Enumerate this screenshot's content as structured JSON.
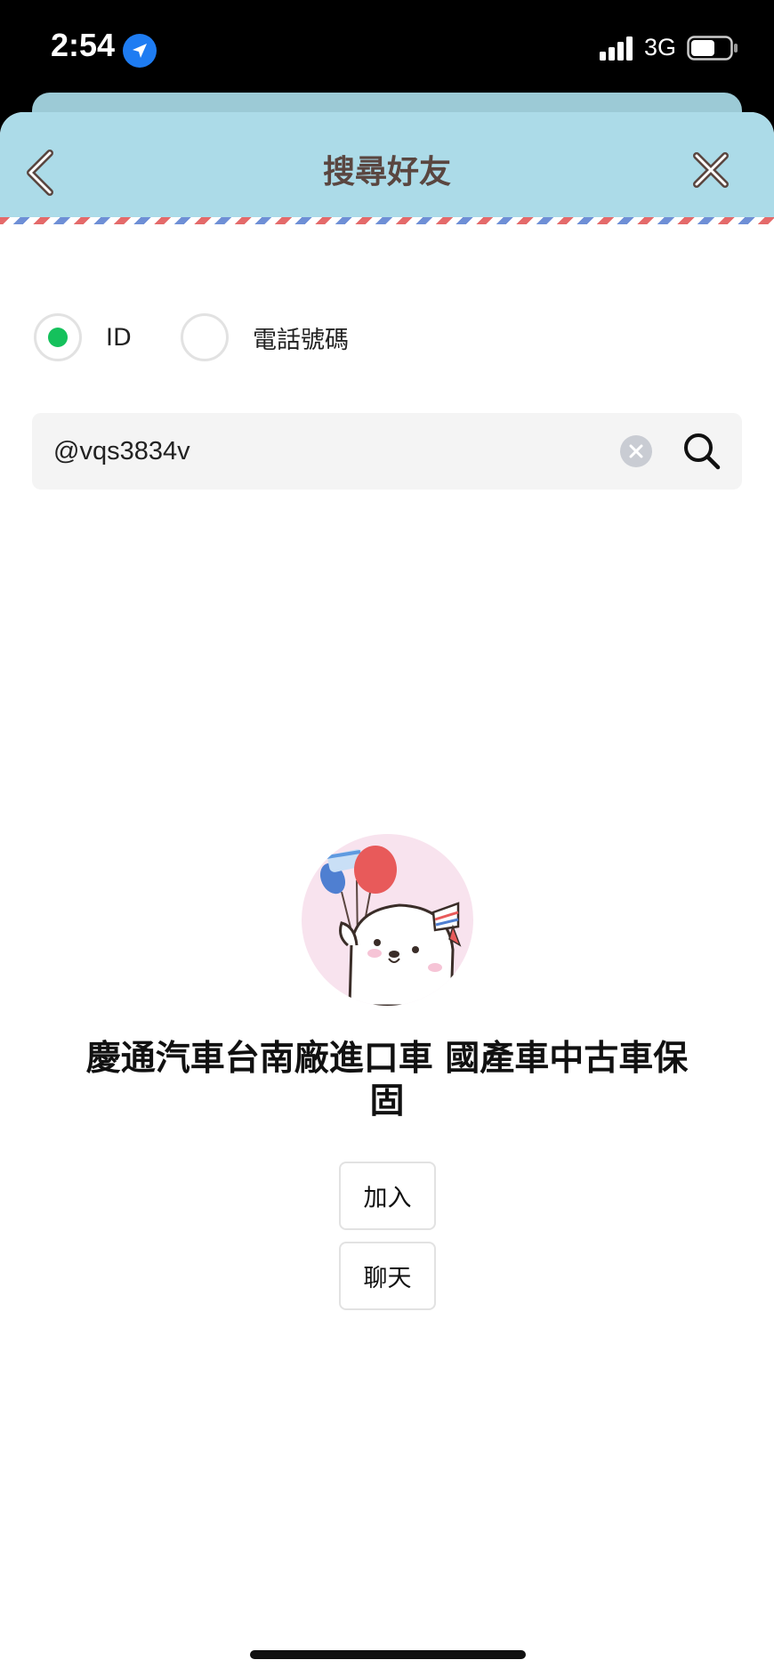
{
  "status_bar": {
    "time": "2:54",
    "network": "3G",
    "icons": [
      "location-arrow-icon",
      "signal-icon",
      "battery-icon"
    ]
  },
  "header": {
    "title": "搜尋好友",
    "back_icon": "chevron-left-icon",
    "close_icon": "close-icon",
    "background_color": "#acdbe8"
  },
  "search_type": {
    "options": [
      {
        "label": "ID",
        "selected": true
      },
      {
        "label": "電話號碼",
        "selected": false
      }
    ],
    "selected_color": "#15c15c"
  },
  "search": {
    "value": "@vqs3834v",
    "clear_icon": "clear-icon",
    "search_icon": "search-icon"
  },
  "result": {
    "name": "慶通汽車台南廠進口車 國產車中古車保固",
    "actions": {
      "add_label": "加入",
      "chat_label": "聊天"
    }
  }
}
